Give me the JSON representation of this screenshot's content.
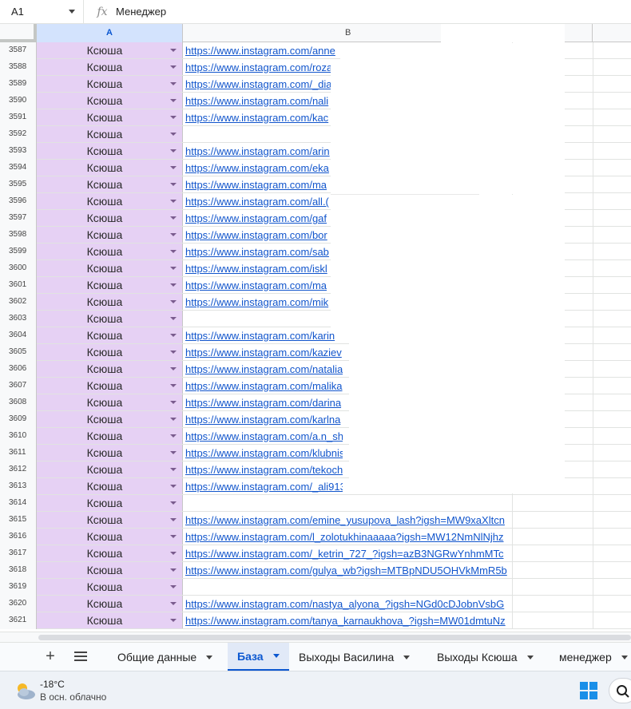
{
  "formula_bar": {
    "cell_ref": "A1",
    "fx_label": "fx",
    "value": "Менеджер"
  },
  "columns": {
    "a": "A",
    "b": "B"
  },
  "rows": [
    {
      "num": "3587",
      "a": "Ксюша",
      "b": "https://www.instagram.com/anne"
    },
    {
      "num": "3588",
      "a": "Ксюша",
      "b": "https://www.instagram.com/roza_"
    },
    {
      "num": "3589",
      "a": "Ксюша",
      "b": "https://www.instagram.com/_dia"
    },
    {
      "num": "3590",
      "a": "Ксюша",
      "b": "https://www.instagram.com/nali"
    },
    {
      "num": "3591",
      "a": "Ксюша",
      "b": "https://www.instagram.com/kac"
    },
    {
      "num": "3592",
      "a": "Ксюша",
      "b": ""
    },
    {
      "num": "3593",
      "a": "Ксюша",
      "b": "https://www.instagram.com/arin"
    },
    {
      "num": "3594",
      "a": "Ксюша",
      "b": "https://www.instagram.com/eka"
    },
    {
      "num": "3595",
      "a": "Ксюша",
      "b": "https://www.instagram.com/ma"
    },
    {
      "num": "3596",
      "a": "Ксюша",
      "b": "https://www.instagram.com/all.("
    },
    {
      "num": "3597",
      "a": "Ксюша",
      "b": "https://www.instagram.com/gaf"
    },
    {
      "num": "3598",
      "a": "Ксюша",
      "b": "https://www.instagram.com/bor"
    },
    {
      "num": "3599",
      "a": "Ксюша",
      "b": "https://www.instagram.com/sab"
    },
    {
      "num": "3600",
      "a": "Ксюша",
      "b": "https://www.instagram.com/iskl"
    },
    {
      "num": "3601",
      "a": "Ксюша",
      "b": "https://www.instagram.com/ma"
    },
    {
      "num": "3602",
      "a": "Ксюша",
      "b": "https://www.instagram.com/mik"
    },
    {
      "num": "3603",
      "a": "Ксюша",
      "b": ""
    },
    {
      "num": "3604",
      "a": "Ксюша",
      "b": "https://www.instagram.com/karin"
    },
    {
      "num": "3605",
      "a": "Ксюша",
      "b": "https://www.instagram.com/kaziev"
    },
    {
      "num": "3606",
      "a": "Ксюша",
      "b": "https://www.instagram.com/natalia"
    },
    {
      "num": "3607",
      "a": "Ксюша",
      "b": "https://www.instagram.com/malika"
    },
    {
      "num": "3608",
      "a": "Ксюша",
      "b": "https://www.instagram.com/darina"
    },
    {
      "num": "3609",
      "a": "Ксюша",
      "b": "https://www.instagram.com/karlna"
    },
    {
      "num": "3610",
      "a": "Ксюша",
      "b": "https://www.instagram.com/a.n_sh"
    },
    {
      "num": "3611",
      "a": "Ксюша",
      "b": "https://www.instagram.com/klubnis"
    },
    {
      "num": "3612",
      "a": "Ксюша",
      "b": "https://www.instagram.com/tekochi"
    },
    {
      "num": "3613",
      "a": "Ксюша",
      "b": "https://www.instagram.com/_ali913"
    },
    {
      "num": "3614",
      "a": "Ксюша",
      "b": ""
    },
    {
      "num": "3615",
      "a": "Ксюша",
      "b": "https://www.instagram.com/emine_yusupova_lash?igsh=MW9xaXltcn"
    },
    {
      "num": "3616",
      "a": "Ксюша",
      "b": "https://www.instagram.com/l_zolotukhinaaaaa?igsh=MW12NmNlNjhz"
    },
    {
      "num": "3617",
      "a": "Ксюша",
      "b": "https://www.instagram.com/_ketrin_727_?igsh=azB3NGRwYnhmMTc"
    },
    {
      "num": "3618",
      "a": "Ксюша",
      "b": "https://www.instagram.com/gulya_wb?igsh=MTBpNDU5OHVkMmR5b"
    },
    {
      "num": "3619",
      "a": "Ксюша",
      "b": ""
    },
    {
      "num": "3620",
      "a": "Ксюша",
      "b": "https://www.instagram.com/nastya_alyona_?igsh=NGd0cDJobnVsbG"
    },
    {
      "num": "3621",
      "a": "Ксюша",
      "b": "https://www.instagram.com/tanya_karnaukhova_?igsh=MW01dmtuNz"
    }
  ],
  "sheet_tabs": [
    {
      "label": "Общие данные",
      "active": false
    },
    {
      "label": "База",
      "active": true
    },
    {
      "label": "Выходы Василина",
      "active": false
    },
    {
      "label": "Выходы Ксюша",
      "active": false
    },
    {
      "label": "менеджер",
      "active": false
    }
  ],
  "taskbar": {
    "temperature": "-18°C",
    "weather_desc": "В осн. облачно"
  },
  "colors": {
    "cell_a_bg": "#e6d1f4",
    "link": "#1155cc",
    "active_tab": "#0b57d0"
  }
}
